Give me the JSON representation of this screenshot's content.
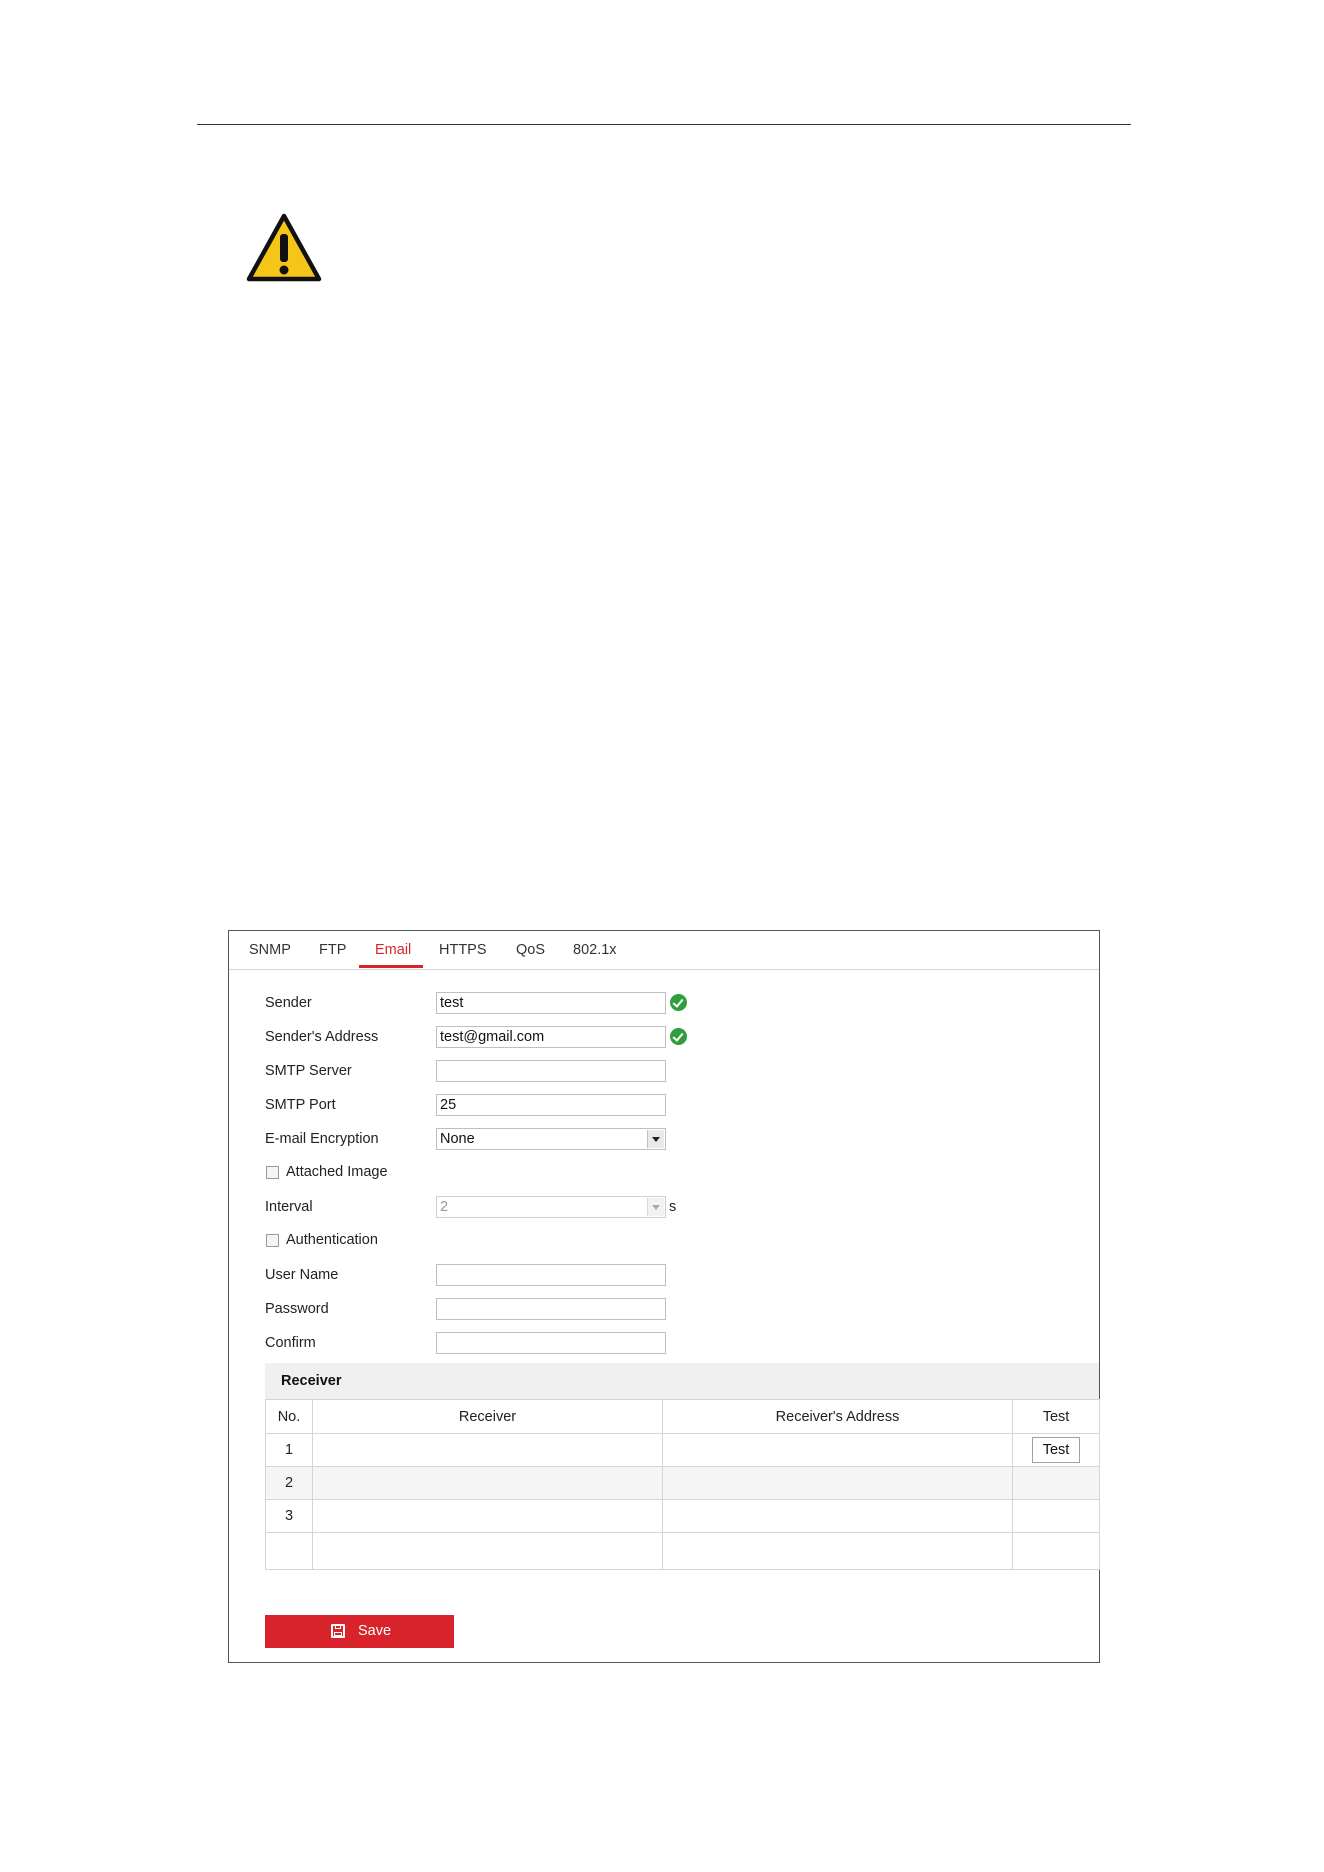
{
  "tabs": [
    "SNMP",
    "FTP",
    "Email",
    "HTTPS",
    "QoS",
    "802.1x"
  ],
  "active_tab": "Email",
  "form": {
    "sender": {
      "label": "Sender",
      "value": "test"
    },
    "sender_address": {
      "label": "Sender's Address",
      "value": "test@gmail.com"
    },
    "smtp_server": {
      "label": "SMTP Server",
      "value": ""
    },
    "smtp_port": {
      "label": "SMTP Port",
      "value": "25"
    },
    "encryption": {
      "label": "E-mail Encryption",
      "value": "None"
    },
    "attached_image": {
      "label": "Attached Image",
      "checked": false
    },
    "interval": {
      "label": "Interval",
      "value": "2",
      "unit": "s"
    },
    "authentication": {
      "label": "Authentication",
      "checked": false
    },
    "user_name": {
      "label": "User Name",
      "value": ""
    },
    "password": {
      "label": "Password",
      "value": ""
    },
    "confirm": {
      "label": "Confirm",
      "value": ""
    }
  },
  "receiver": {
    "section_title": "Receiver",
    "columns": [
      "No.",
      "Receiver",
      "Receiver's Address",
      "Test"
    ],
    "rows": [
      {
        "no": "1",
        "receiver": "",
        "address": "",
        "test_label": "Test"
      },
      {
        "no": "2",
        "receiver": "",
        "address": ""
      },
      {
        "no": "3",
        "receiver": "",
        "address": ""
      }
    ]
  },
  "save_label": "Save",
  "colors": {
    "accent": "#d6262c",
    "valid": "#2f9e3c",
    "warning": "#f5c518"
  },
  "icons": {
    "warning": "warning-icon",
    "valid": "check-circle-icon",
    "save": "floppy-disk-icon"
  }
}
